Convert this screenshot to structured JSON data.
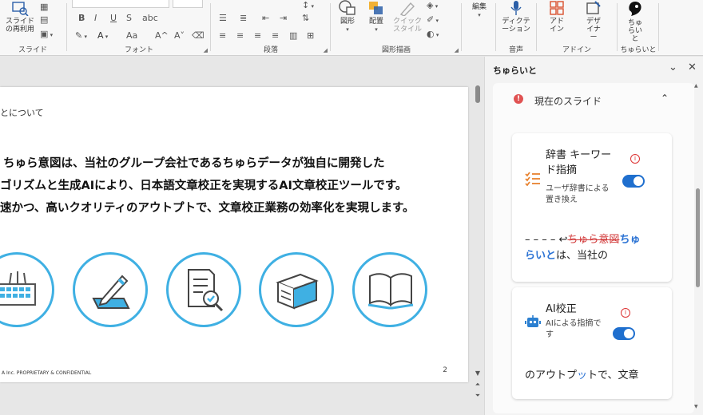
{
  "ribbon": {
    "groups": [
      {
        "label": "スライド"
      },
      {
        "label": "フォント"
      },
      {
        "label": "段落"
      },
      {
        "label": "図形描画"
      },
      {
        "label": "音声"
      },
      {
        "label": "アドイン"
      },
      {
        "label": "ちゅらいと"
      }
    ],
    "buttons": {
      "reuse": "スライドの再利用",
      "shapes": "図形",
      "arrange": "配置",
      "quick_styles": "クイック スタイル",
      "edit": "編集",
      "dictate": "ディクテーション",
      "addins": "アドイン",
      "designer": "デザイナー",
      "churaito": "ちゅらいと"
    },
    "font_buttons": {
      "bold": "B",
      "italic": "I",
      "underline": "U",
      "strike": "S",
      "aa": "Aa",
      "grow": "A^",
      "shrink": "A˅"
    }
  },
  "slide": {
    "heading": "とについて",
    "lines": [
      "ちゅら意図は、当社のグループ会社であるちゅらデータが独自に開発した",
      "ゴリズムと生成AIにより、日本語文章校正を実現するAI文章校正ツールです。",
      "速かつ、高いクオリティのアウトプトで、文章校正業務の効率化を実現します。"
    ],
    "footer": "A Inc. PROPRIETARY & CONFIDENTIAL",
    "page_number": "2",
    "icons": [
      "keyboard-icon",
      "pen-writing-icon",
      "document-magnifier-icon",
      "document-stack-icon",
      "open-book-icon"
    ]
  },
  "pane": {
    "title": "ちゅらいと",
    "section_title": "現在のスライド",
    "alert_mark": "!",
    "info_mark": "i",
    "cards": [
      {
        "title_line1": "辞書 キーワー",
        "title_line2": "ド指摘",
        "subtitle_line1": "ユーザ辞書による",
        "subtitle_line2": "置き換え",
        "toggle_on": true,
        "preview_prefix": "– – – – ↩",
        "preview_deleted": "ちゅら意図",
        "preview_inserted_1": "ちゅ",
        "preview_inserted_2": "らいと",
        "preview_rest": "は、当社の"
      },
      {
        "title": "AI校正",
        "subtitle_line1": "AIによる指摘で",
        "subtitle_line2": "す",
        "toggle_on": true,
        "preview_before": "のアウトプ",
        "preview_inserted": "ッ",
        "preview_after": "トで、文章"
      }
    ]
  },
  "colors": {
    "accent": "#1f6fce",
    "circle": "#3fb0e3",
    "deleted": "#d23a3a",
    "alert": "#e05252"
  }
}
